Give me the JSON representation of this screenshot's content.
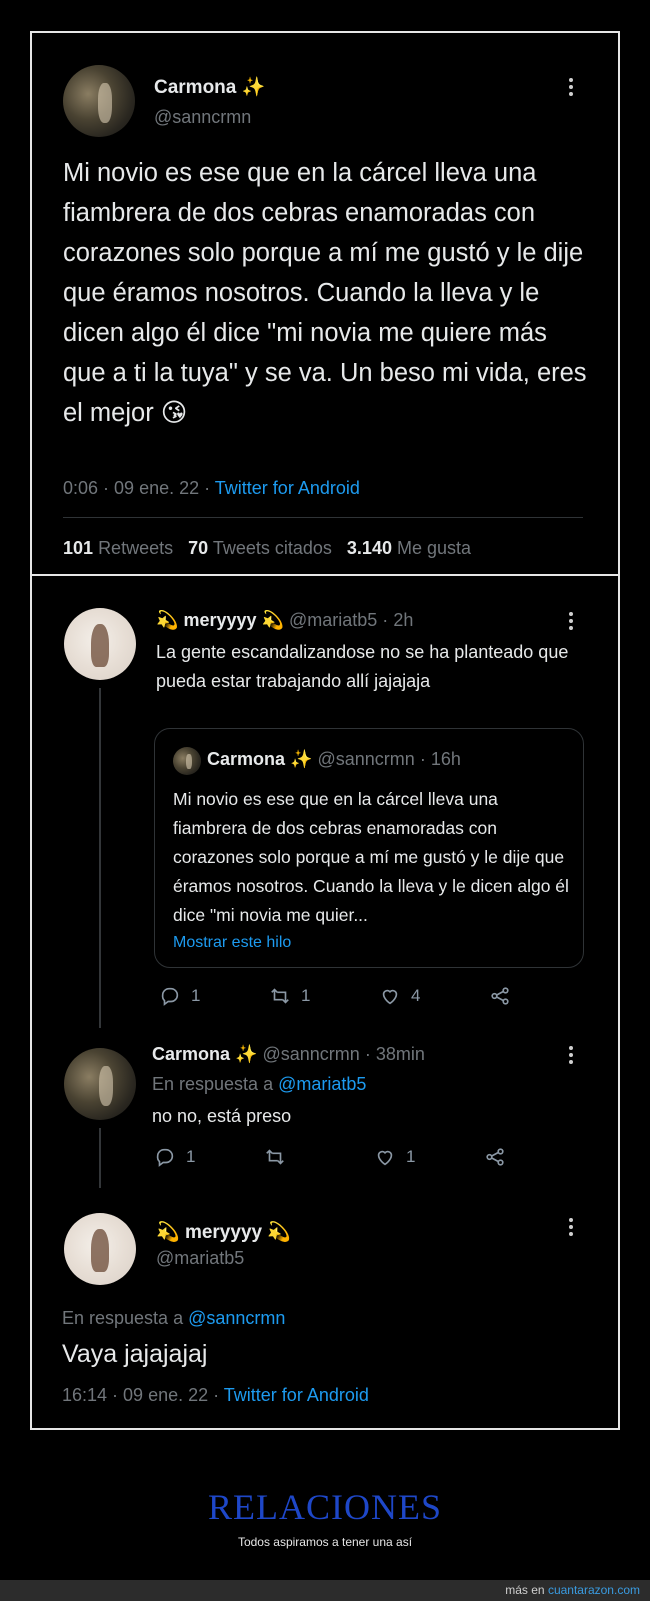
{
  "tweet1": {
    "display_name": "Carmona",
    "name_emoji": "✨",
    "handle": "@sanncrmn",
    "body": "Mi novio es ese que en la cárcel lleva una fiambrera de dos cebras enamoradas con corazones solo porque a mí me gustó y le dije que éramos nosotros. Cuando la lleva y le dicen algo él dice \"mi novia me quiere más que a ti la tuya\" y se va. Un beso mi vida, eres el mejor",
    "body_emoji": "😘",
    "time": "0:06",
    "date": "09 ene. 22",
    "source": "Twitter for Android",
    "retweets_count": "101",
    "retweets_label": "Retweets",
    "quotes_count": "70",
    "quotes_label": "Tweets citados",
    "likes_count": "3.140",
    "likes_label": "Me gusta"
  },
  "reply1": {
    "display_name": "meryyyy",
    "name_emoji": "💫",
    "handle": "@mariatb5",
    "age": "2h",
    "body": "La gente escandalizandose no se ha planteado que pueda estar trabajando allí jajajaja",
    "quoted": {
      "display_name": "Carmona",
      "name_emoji": "✨",
      "handle": "@sanncrmn",
      "age": "16h",
      "body": "Mi novio es ese que en la cárcel lleva una fiambrera de dos cebras enamoradas con corazones solo porque a mí me gustó y le dije que éramos nosotros. Cuando la lleva y le dicen algo él dice \"mi novia me quier...",
      "show_thread": "Mostrar este hilo"
    },
    "replies": "1",
    "retweets": "1",
    "likes": "4"
  },
  "reply2": {
    "display_name": "Carmona",
    "name_emoji": "✨",
    "handle": "@sanncrmn",
    "age": "38min",
    "in_reply_prefix": "En respuesta a",
    "in_reply_handle": "@mariatb5",
    "body": "no no, está preso",
    "replies": "1",
    "likes": "1"
  },
  "reply3": {
    "display_name": "meryyyy",
    "name_emoji": "💫",
    "handle": "@mariatb5",
    "in_reply_prefix": "En respuesta a",
    "in_reply_handle": "@sanncrmn",
    "body": "Vaya jajajajaj",
    "time": "16:14",
    "date": "09 ene. 22",
    "source": "Twitter for Android"
  },
  "footer": {
    "title": "RELACIONES",
    "subtitle": "Todos aspiramos a tener una así",
    "more_prefix": "más en",
    "more_link": "cuantarazon.com"
  },
  "colors": {
    "background": "#000000",
    "text": "#e7e9ea",
    "muted": "#71767b",
    "link": "#1d9bf0",
    "footer_title": "#1e47c8"
  },
  "icons": [
    "more-icon",
    "reply-icon",
    "retweet-icon",
    "like-icon",
    "share-icon"
  ]
}
